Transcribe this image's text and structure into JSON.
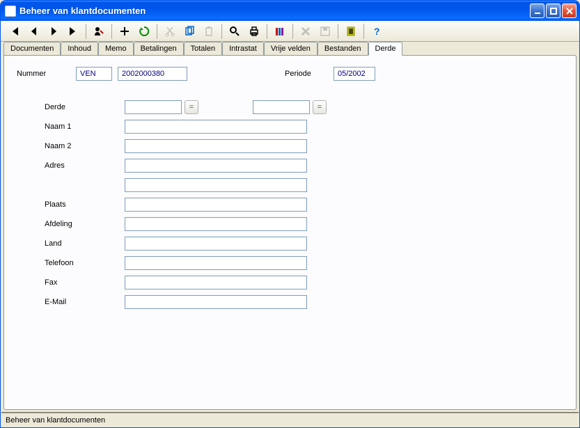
{
  "window": {
    "title": "Beheer van klantdocumenten"
  },
  "tabs": [
    {
      "label": "Documenten"
    },
    {
      "label": "Inhoud"
    },
    {
      "label": "Memo"
    },
    {
      "label": "Betalingen"
    },
    {
      "label": "Totalen"
    },
    {
      "label": "Intrastat"
    },
    {
      "label": "Vrije velden"
    },
    {
      "label": "Bestanden"
    },
    {
      "label": "Derde"
    }
  ],
  "active_tab_index": 8,
  "header": {
    "nummer_label": "Nummer",
    "nummer_type": "VEN",
    "nummer_value": "2002000380",
    "periode_label": "Periode",
    "periode_value": "05/2002"
  },
  "form": {
    "derde_label": "Derde",
    "derde_value1": "",
    "derde_value2": "",
    "eq_button": "=",
    "naam1_label": "Naam 1",
    "naam1_value": "",
    "naam2_label": "Naam 2",
    "naam2_value": "",
    "adres_label": "Adres",
    "adres_value1": "",
    "adres_value2": "",
    "plaats_label": "Plaats",
    "plaats_value": "",
    "afdeling_label": "Afdeling",
    "afdeling_value": "",
    "land_label": "Land",
    "land_value": "",
    "telefoon_label": "Telefoon",
    "telefoon_value": "",
    "fax_label": "Fax",
    "fax_value": "",
    "email_label": "E-Mail",
    "email_value": ""
  },
  "statusbar": {
    "text": "Beheer van klantdocumenten"
  }
}
